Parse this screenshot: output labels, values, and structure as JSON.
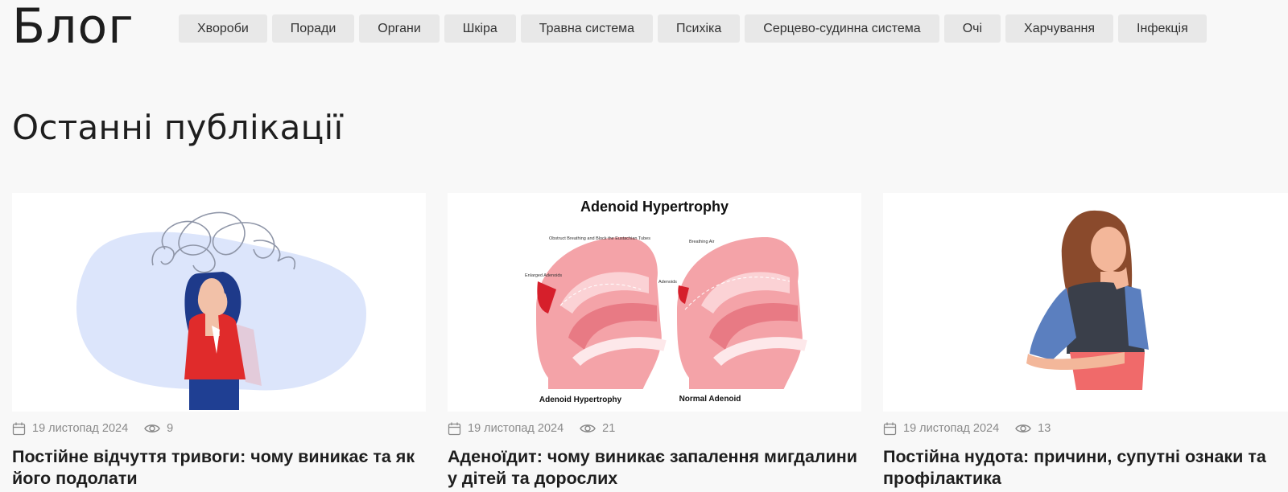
{
  "header": {
    "title": "Блог"
  },
  "tags": [
    "Хвороби",
    "Поради",
    "Органи",
    "Шкіра",
    "Травна система",
    "Психіка",
    "Серцево-судинна система",
    "Очі",
    "Харчування",
    "Інфекція"
  ],
  "section": {
    "title": "Останні публікації"
  },
  "posts": [
    {
      "date": "19 листопад 2024",
      "views": "9",
      "title": "Постійне відчуття тривоги: чому виникає та як його подолати",
      "image": "anxious-woman-illustration"
    },
    {
      "date": "19 листопад 2024",
      "views": "21",
      "title": "Аденоїдит: чому виникає запалення мигдалини у дітей та дорослих",
      "image": "adenoid-hypertrophy-diagram",
      "image_text": {
        "heading": "Adenoid Hypertrophy",
        "label_left": "Adenoid Hypertrophy",
        "label_right": "Normal Adenoid",
        "annot_obstruct": "Obstruct Breathing and Block the Eustachian Tubes",
        "annot_enlarged": "Enlarged Adenoids",
        "annot_breathing": "Breathing Air",
        "annot_adenoids": "Adenoids"
      }
    },
    {
      "date": "19 листопад 2024",
      "views": "13",
      "title": "Постійна нудота: причини, супутні ознаки та профілактика",
      "image": "nauseous-woman-illustration"
    }
  ],
  "icons": {
    "date": "calendar-icon",
    "views": "eye-icon"
  },
  "colors": {
    "background": "#f8f8f8",
    "tag_bg": "#e8e8e8",
    "meta": "#8a8a8a",
    "text": "#1e1e1e"
  }
}
